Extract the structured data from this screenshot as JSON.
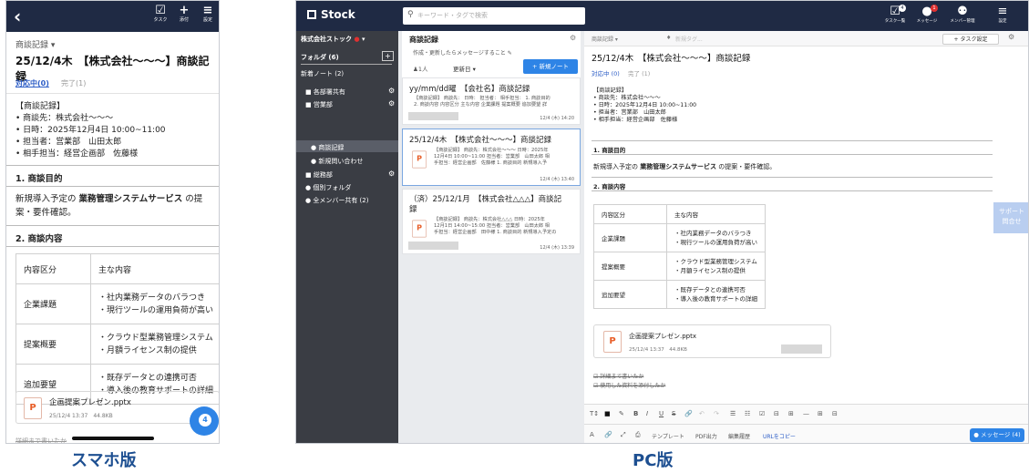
{
  "phone": {
    "caption": "スマホ版",
    "toolbar": [
      {
        "icon": "☑",
        "label": "タスク",
        "name": "task-icon"
      },
      {
        "icon": "+",
        "label": "添付",
        "name": "attach-icon"
      },
      {
        "icon": "≡",
        "label": "設定",
        "name": "settings-icon"
      }
    ],
    "category": "商談記録",
    "title": "25/12/4木　【株式会社～～～】商談記録",
    "status_active": "対応中(0)",
    "status_done": "完了(1)",
    "body_lines": [
      "【商談記録】",
      "• 商談先：株式会社～～～",
      "• 日時：2025年12月4日 10:00~11:00",
      "• 担当者：営業部　山田太郎",
      "• 相手担当：経営企画部　佐藤様"
    ],
    "h1": "1. 商談目的",
    "p1_pre": "新規導入予定の ",
    "p1_bold": "業務管理システムサービス",
    "p1_post": " の提案・要件確認。",
    "h2": "2. 商談内容",
    "table": {
      "header": [
        "内容区分",
        "主な内容"
      ],
      "rows": [
        [
          "企業課題",
          "・社内業務データのバラつき",
          "・現行ツールの運用負荷が高い"
        ],
        [
          "提案概要",
          "・クラウド型業務管理システム",
          "・月額ライセンス制の提供"
        ],
        [
          "追加要望",
          "・既存データとの連携可否",
          "・導入後の教育サポートの詳細"
        ]
      ]
    },
    "attachment": {
      "name": "企画提案プレゼン.pptx",
      "meta": "25/12/4 13:37　44.8KB"
    },
    "message_count": "4",
    "partial_bottom": "詳細まで書いたか"
  },
  "pc": {
    "caption": "PC版",
    "logo": "Stock",
    "search_placeholder": "キーワード・タグで検索",
    "toolbar": [
      {
        "icon": "☑",
        "label": "タスク一覧",
        "badge": "4",
        "name": "task-list-icon"
      },
      {
        "icon": "●",
        "label": "メッセージ",
        "badge": "1",
        "name": "message-icon"
      },
      {
        "icon": "⚉",
        "label": "メンバー管理",
        "badge": "",
        "name": "members-icon"
      },
      {
        "icon": "≡",
        "label": "設定",
        "badge": "",
        "name": "settings-icon"
      }
    ],
    "sidebar": {
      "company": "株式会社ストック",
      "folder_label": "フォルダ (6)",
      "new_notes": "新着ノート (2)",
      "items": [
        {
          "label": "■ 各部署共有",
          "gear": true
        },
        {
          "label": "■ 営業部",
          "gear": true
        },
        {
          "label": "● 商談記録",
          "gear": false
        },
        {
          "label": "● 新規問い合わせ",
          "gear": false
        },
        {
          "label": "■ 総務部",
          "gear": true
        },
        {
          "label": "● 個別フォルダ",
          "gear": false
        },
        {
          "label": "● 全メンバー共有 (2)",
          "gear": false
        }
      ]
    },
    "list": {
      "folder_title": "商談記録",
      "folder_desc": "作成・更新したらメッセージすること ✎",
      "members": "1人",
      "sort": "更新日 ▾",
      "new_note_btn": "+ 新規ノート",
      "notes": [
        {
          "title": "yy/mm/dd曜　【会社名】商談記録",
          "snippet": [
            "【商談記録】 商談先： 日時： 担当者： 相手担当： 1. 商談目的",
            "2. 商談内容 内容区分 主な内容 企業課題 提案概要 追加要望 詳"
          ],
          "date": "12/4 (木) 14:20"
        },
        {
          "title": "25/12/4木　【株式会社～～～】商談記録",
          "snippet": [
            "【商談記録】 商談先：株式会社～～～ 日時：2025年",
            "12月4日 10:00~11:00 担当者：営業部　山田太郎 相",
            "手担当：経営企画部　佐藤様 1. 商談目的 新規導入予"
          ],
          "date": "12/4 (木) 13:40"
        },
        {
          "title": "（済）25/12/1月　【株式会社△△△】商談記",
          "title2": "録",
          "snippet": [
            "【商談記録】 商談先：株式会社△△△ 日時：2025年",
            "12月1日 14:00~15:00 担当者：営業部　山田太郎 相",
            "手担当：経営企画部　田中様 1. 商談目的 新規導入予定の"
          ],
          "date": "12/4 (木) 13:39"
        }
      ]
    },
    "main": {
      "category": "商談記録 ▾",
      "tag_placeholder": "新規タグ...",
      "task_btn": "+ タスク設定",
      "title": "25/12/4木　【株式会社～～～】商談記録",
      "status_active": "対応中 (0)",
      "status_done": "完了 (1)",
      "body_lines": [
        "【商談記録】",
        "• 商談先：株式会社～～～",
        "• 日時：2025年12月4日 10:00~11:00",
        "• 担当者：営業部　山田太郎",
        "• 相手担当：経営企画部　佐藤様"
      ],
      "h1": "1. 商談目的",
      "p1_pre": "新規導入予定の ",
      "p1_bold": "業務管理システムサービス",
      "p1_post": " の提案・要件確認。",
      "h2": "2. 商談内容",
      "attachment": {
        "name": "企画提案プレゼン.pptx",
        "meta": "25/12/4 13:37　44.8KB"
      },
      "check1": "☑ 詳細まで書いたか",
      "check2": "☑ 使用した資料を添付したか",
      "support": [
        "サポート",
        "問合せ"
      ],
      "format_tools": [
        "T↕",
        "■",
        "✎",
        "B",
        "I",
        "U",
        "S",
        "🔗",
        "↶",
        "↷",
        "☰",
        "☷",
        "☑",
        "⊟",
        "⊞",
        "—",
        "⊞",
        "⊟"
      ],
      "bottom_tools": [
        "A",
        "🔗",
        "⤢",
        "⎙",
        "テンプレート",
        "PDF出力",
        "編集履歴",
        "URLをコピー"
      ],
      "message_btn": "● メッセージ (4)"
    }
  }
}
